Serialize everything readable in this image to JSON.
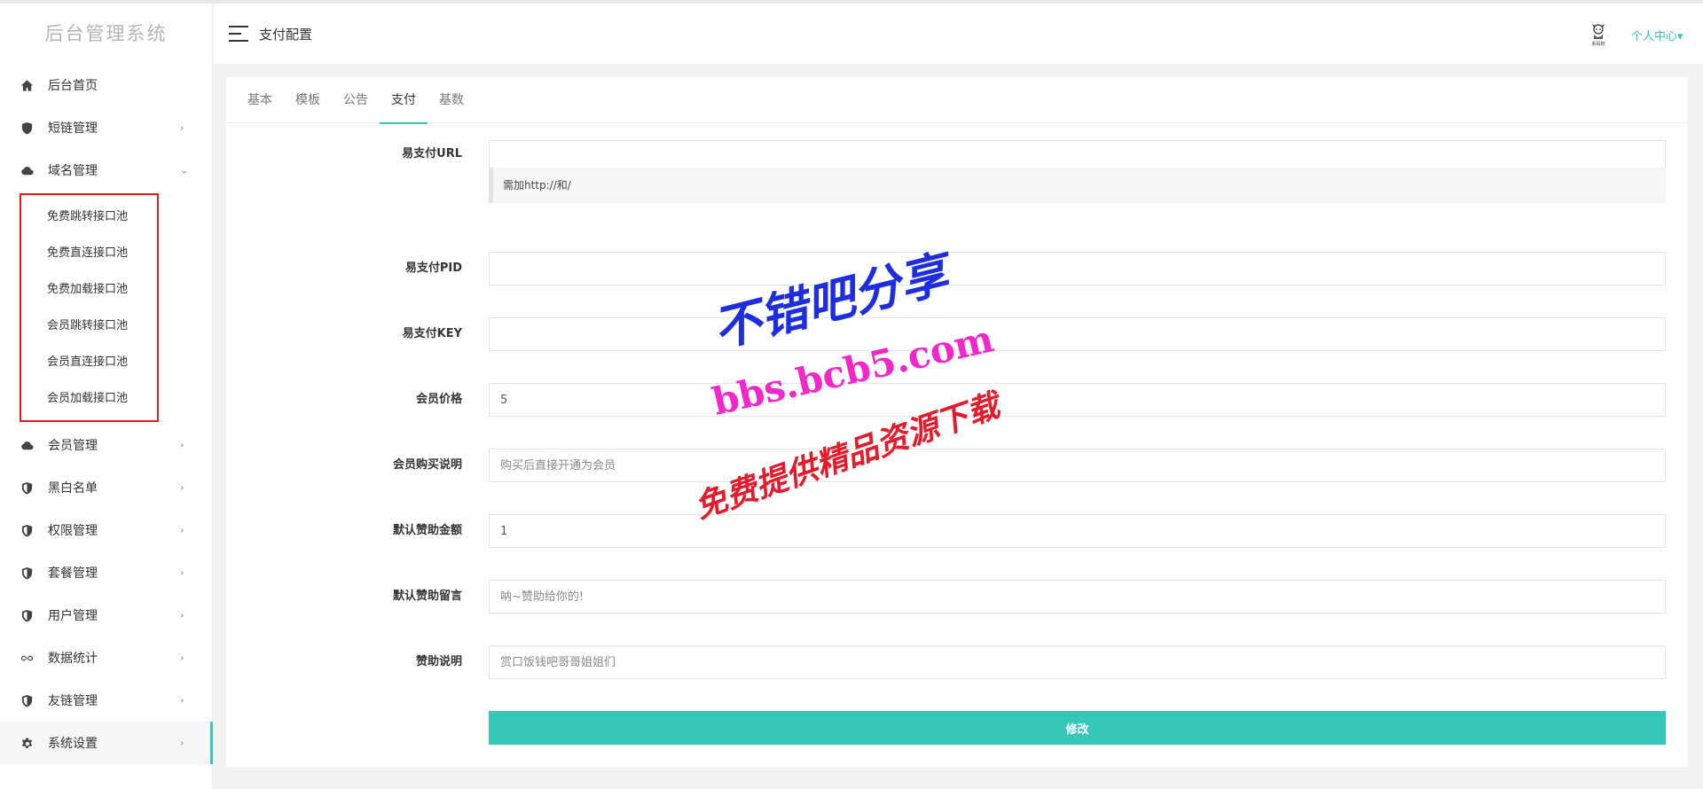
{
  "app": {
    "logo": "后台管理系统"
  },
  "header": {
    "title": "支付配置",
    "user_menu": "个人中心▾",
    "avatar_caption": "系码狗"
  },
  "sidebar": {
    "items": [
      {
        "label": "后台首页",
        "icon": "home-icon",
        "arrow": ""
      },
      {
        "label": "短链管理",
        "icon": "shield-icon",
        "arrow": "›"
      },
      {
        "label": "域名管理",
        "icon": "cloud-icon",
        "arrow": "⌄"
      },
      {
        "label": "会员管理",
        "icon": "cloud-icon",
        "arrow": "›"
      },
      {
        "label": "黑白名单",
        "icon": "shield-check-icon",
        "arrow": "›"
      },
      {
        "label": "权限管理",
        "icon": "shield-check-icon",
        "arrow": "›"
      },
      {
        "label": "套餐管理",
        "icon": "shield-check-icon",
        "arrow": "›"
      },
      {
        "label": "用户管理",
        "icon": "shield-check-icon",
        "arrow": "›"
      },
      {
        "label": "数据统计",
        "icon": "infinity-icon",
        "arrow": "›"
      },
      {
        "label": "友链管理",
        "icon": "shield-check-icon",
        "arrow": "›"
      },
      {
        "label": "系统设置",
        "icon": "gear-icon",
        "arrow": "›"
      }
    ],
    "sub_items": [
      "免费跳转接口池",
      "免费直连接口池",
      "免费加载接口池",
      "会员跳转接口池",
      "会员直连接口池",
      "会员加载接口池"
    ]
  },
  "tabs": [
    "基本",
    "模板",
    "公告",
    "支付",
    "基数"
  ],
  "form": {
    "epay_url": {
      "label": "易支付URL",
      "value": "",
      "hint": "需加http://和/"
    },
    "epay_pid": {
      "label": "易支付PID",
      "value": ""
    },
    "epay_key": {
      "label": "易支付KEY",
      "value": ""
    },
    "member_price": {
      "label": "会员价格",
      "value": "5"
    },
    "member_desc": {
      "label": "会员购买说明",
      "placeholder": "购买后直接开通为会员"
    },
    "default_amount": {
      "label": "默认赞助金额",
      "value": "1"
    },
    "default_message": {
      "label": "默认赞助留言",
      "placeholder": "呐~赞助给你的!"
    },
    "sponsor_desc": {
      "label": "赞助说明",
      "placeholder": "赏口饭钱吧哥哥姐姐们"
    },
    "submit_label": "修改"
  },
  "watermark": {
    "line1": "不错吧分享",
    "line2": "bbs.bcb5.com",
    "line3": "免费提供精品资源下载"
  },
  "colors": {
    "accent": "#35c8b8",
    "highlight_border": "#e21b1b"
  }
}
